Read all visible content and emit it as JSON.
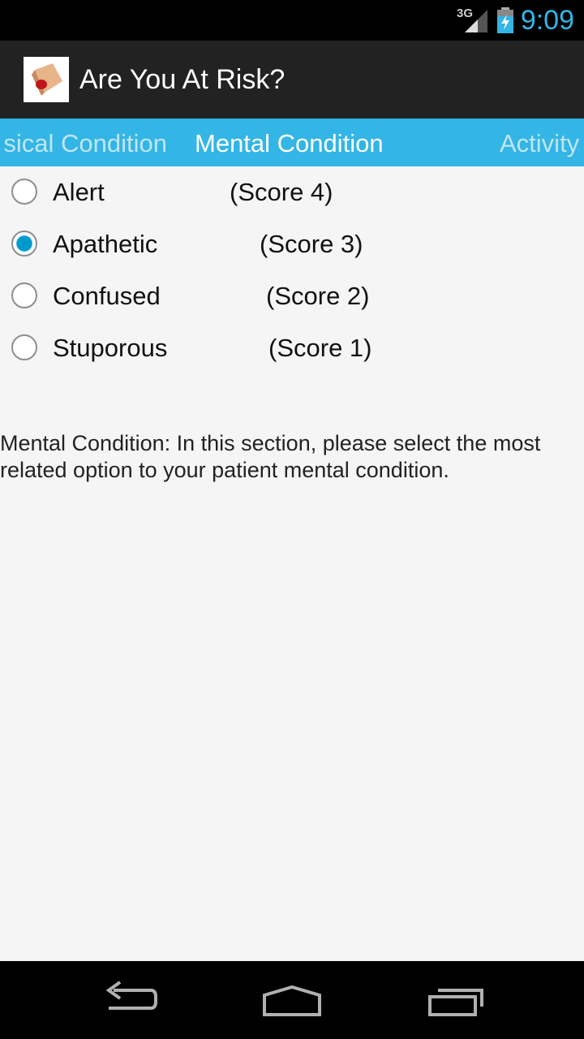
{
  "status_bar": {
    "network_label": "3G",
    "time": "9:09",
    "accent_color": "#33b5e5",
    "icons": [
      "signal-icon",
      "battery-charging-icon"
    ]
  },
  "action_bar": {
    "title": "Are You At Risk?",
    "icon": "app-icon"
  },
  "tabs": {
    "previous": "sical Condition",
    "current": "Mental Condition",
    "next": "Activity",
    "color": "#33b5e5"
  },
  "options": [
    {
      "label": "Alert",
      "score": "(Score 4)",
      "checked": false
    },
    {
      "label": "Apathetic",
      "score": "(Score 3)",
      "checked": true
    },
    {
      "label": "Confused",
      "score": "(Score 2)",
      "checked": false
    },
    {
      "label": "Stuporous",
      "score": "(Score 1)",
      "checked": false
    }
  ],
  "description": " Mental Condition: In this section, please select the most related option to your patient mental condition.",
  "nav_bar": {
    "icons": [
      "back-icon",
      "home-icon",
      "recent-apps-icon"
    ]
  }
}
